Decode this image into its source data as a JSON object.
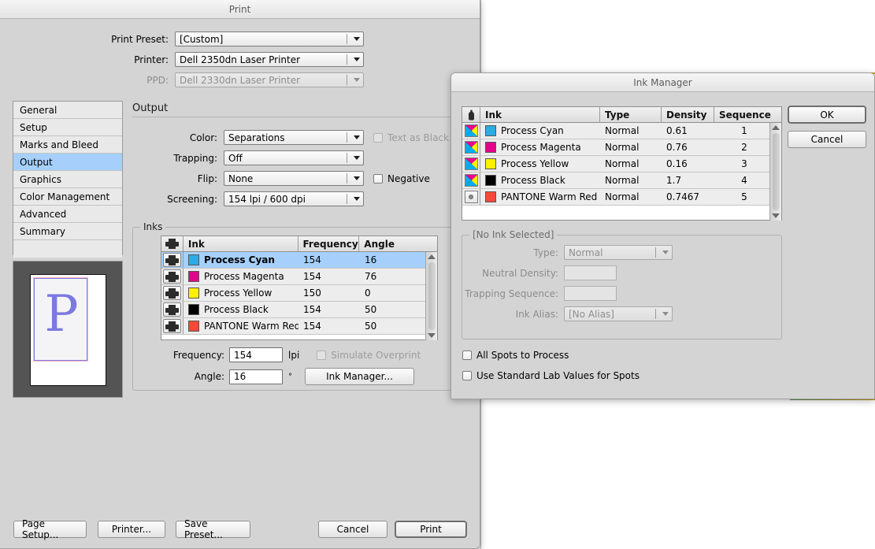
{
  "print_dialog": {
    "title": "Print",
    "fields": [
      {
        "label": "Print Preset:",
        "value": "[Custom]",
        "disabled": false
      },
      {
        "label": "Printer:",
        "value": "Dell 2350dn Laser Printer",
        "disabled": false
      },
      {
        "label": "PPD:",
        "value": "Dell 2330dn Laser Printer",
        "disabled": true
      }
    ],
    "panes": [
      "General",
      "Setup",
      "Marks and Bleed",
      "Output",
      "Graphics",
      "Color Management",
      "Advanced",
      "Summary"
    ],
    "selected_pane": "Output",
    "preview_glyph": "P",
    "output": {
      "heading": "Output",
      "color_label": "Color:",
      "color_value": "Separations",
      "trapping_label": "Trapping:",
      "trapping_value": "Off",
      "flip_label": "Flip:",
      "flip_value": "None",
      "screening_label": "Screening:",
      "screening_value": "154 lpi / 600 dpi",
      "text_as_black_label": "Text as Black",
      "negative_label": "Negative"
    },
    "inks_group": {
      "title": "Inks",
      "columns": [
        "",
        "Ink",
        "Frequency",
        "Angle"
      ],
      "rows": [
        {
          "ink": "Process Cyan",
          "frequency": "154",
          "angle": "16",
          "color": "#29ADE3",
          "selected": true
        },
        {
          "ink": "Process Magenta",
          "frequency": "154",
          "angle": "76",
          "color": "#E0068C",
          "selected": false
        },
        {
          "ink": "Process Yellow",
          "frequency": "150",
          "angle": "0",
          "color": "#FFF000",
          "selected": false
        },
        {
          "ink": "Process Black",
          "frequency": "154",
          "angle": "50",
          "color": "#000000",
          "selected": false
        },
        {
          "ink": "PANTONE Warm Red C",
          "frequency": "154",
          "angle": "50",
          "color": "#F9483A",
          "selected": false
        }
      ],
      "frequency_label": "Frequency:",
      "frequency_value": "154",
      "frequency_unit": "lpi",
      "angle_label": "Angle:",
      "angle_value": "16",
      "angle_unit": "°",
      "simulate_overprint_label": "Simulate Overprint",
      "ink_manager_button": "Ink Manager..."
    },
    "footer": {
      "page_setup": "Page Setup...",
      "printer": "Printer...",
      "save_preset": "Save Preset...",
      "cancel": "Cancel",
      "print": "Print"
    }
  },
  "ink_manager": {
    "title": "Ink Manager",
    "columns": [
      "",
      "Ink",
      "Type",
      "Density",
      "Sequence"
    ],
    "rows": [
      {
        "ink": "Process Cyan",
        "type": "Normal",
        "density": "0.61",
        "sequence": "1",
        "color": "#29ADE3",
        "kind": "process"
      },
      {
        "ink": "Process Magenta",
        "type": "Normal",
        "density": "0.76",
        "sequence": "2",
        "color": "#E0068C",
        "kind": "process"
      },
      {
        "ink": "Process Yellow",
        "type": "Normal",
        "density": "0.16",
        "sequence": "3",
        "color": "#FFF000",
        "kind": "process"
      },
      {
        "ink": "Process Black",
        "type": "Normal",
        "density": "1.7",
        "sequence": "4",
        "color": "#000000",
        "kind": "process"
      },
      {
        "ink": "PANTONE Warm Red C",
        "type": "Normal",
        "density": "0.7467",
        "sequence": "5",
        "color": "#F9483A",
        "kind": "spot"
      }
    ],
    "buttons": {
      "ok": "OK",
      "cancel": "Cancel"
    },
    "detail": {
      "group_title": "[No Ink Selected]",
      "type_label": "Type:",
      "type_value": "Normal",
      "neutral_density_label": "Neutral Density:",
      "neutral_density_value": "",
      "trapping_sequence_label": "Trapping Sequence:",
      "trapping_sequence_value": "",
      "ink_alias_label": "Ink Alias:",
      "ink_alias_value": "[No Alias]"
    },
    "all_spots_label": "All Spots to Process",
    "standard_lab_label": "Use Standard Lab Values for Spots"
  }
}
